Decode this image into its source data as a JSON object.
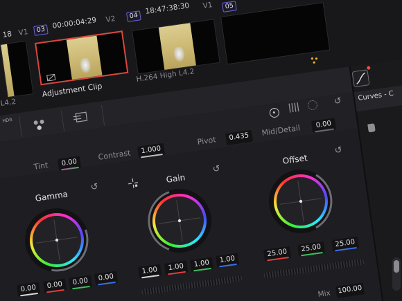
{
  "timeline": {
    "clips": [
      {
        "timecode": "18",
        "track": "V1",
        "label": "L4.2"
      },
      {
        "number": "03",
        "timecode": "00:00:04:29",
        "track": "V2",
        "label": "Adjustment Clip",
        "selected": true
      },
      {
        "number": "04",
        "timecode": "18:47:38:30",
        "track": "V1",
        "label": "H.264 High L4.2"
      },
      {
        "number": "05"
      }
    ]
  },
  "toolbar": {
    "hdr_label": "HDR"
  },
  "curves_panel": {
    "title": "Curves - C"
  },
  "primaries": {
    "tint": {
      "label": "Tint",
      "value": "0.00"
    },
    "contrast": {
      "label": "Contrast",
      "value": "1.000"
    },
    "pivot": {
      "label": "Pivot",
      "value": "0.435"
    },
    "mid_detail": {
      "label": "Mid/Detail",
      "value": "0.00"
    },
    "wheels": [
      {
        "name": "Gamma",
        "values": [
          "0.00",
          "0.00",
          "0.00",
          "0.00"
        ]
      },
      {
        "name": "Gain",
        "values": [
          "1.00",
          "1.00",
          "1.00",
          "1.00"
        ]
      },
      {
        "name": "Offset",
        "values": [
          "25.00",
          "25.00",
          "25.00"
        ]
      }
    ],
    "mix": {
      "label": "Mix",
      "value": "100.00"
    }
  },
  "colors": {
    "selected_clip_border": "#d8483e",
    "red_channel": "#e0403a",
    "green_channel": "#3fbf5a",
    "blue_channel": "#3b6ee8",
    "badge_border": "#6d62d8"
  }
}
